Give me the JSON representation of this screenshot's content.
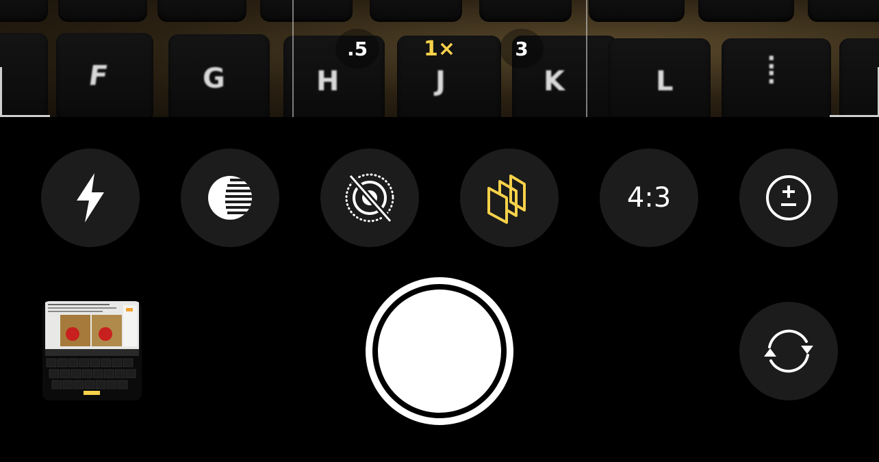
{
  "zoom": {
    "options": [
      ".5",
      "1×",
      "3"
    ],
    "active": "1×"
  },
  "keyboard_keys": [
    "F",
    "G",
    "H",
    "J",
    "K",
    "L"
  ],
  "controls": [
    {
      "id": "flash",
      "icon": "flash-icon"
    },
    {
      "id": "night-mode",
      "icon": "night-mode-icon"
    },
    {
      "id": "live-photo",
      "icon": "live-photo-off-icon"
    },
    {
      "id": "styles",
      "icon": "photographic-styles-icon"
    },
    {
      "id": "aspect-ratio",
      "label": "4:3"
    },
    {
      "id": "exposure",
      "icon": "exposure-icon"
    }
  ],
  "colors": {
    "accent": "#f7d14a",
    "button_bg": "#1c1c1c",
    "background": "#000000"
  }
}
